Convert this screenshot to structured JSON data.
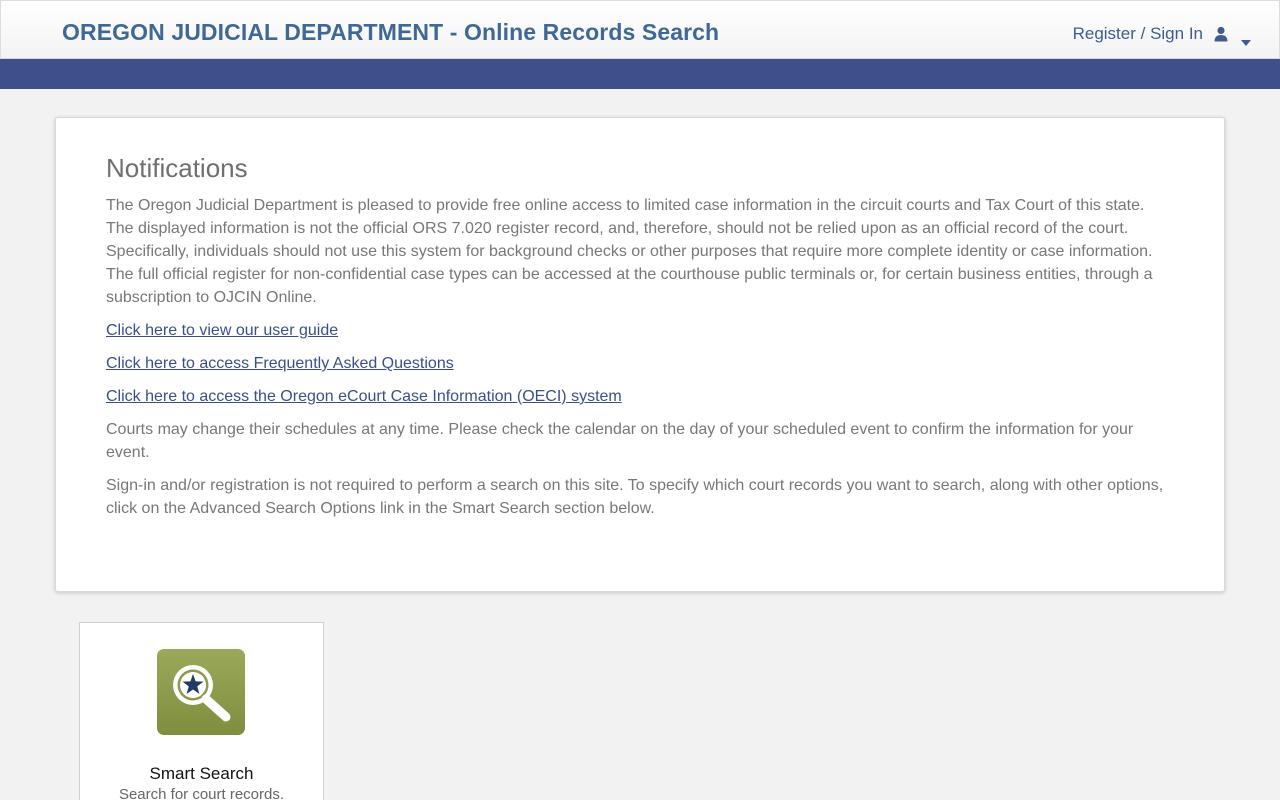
{
  "header": {
    "title": "OREGON JUDICIAL DEPARTMENT - Online Records Search",
    "account_label": "Register / Sign In",
    "user_icon": "user-icon",
    "caret_icon": "caret-down-icon"
  },
  "notifications": {
    "heading": "Notifications",
    "intro": "The Oregon Judicial Department is pleased to provide free online access to limited case information in the circuit courts and Tax Court of this state. The displayed information is not the official ORS 7.020 register record, and, therefore, should not be relied upon as an official record of the court. Specifically, individuals should not use this system for background checks or other purposes that require more complete identity or case information. The full official register for non-confidential case types can be accessed at the courthouse public terminals or, for certain business entities, through a subscription to OJCIN Online.",
    "links": [
      "Click here to view our user guide",
      "Click here to access Frequently Asked Questions",
      "Click here to access the Oregon eCourt Case Information (OECI) system"
    ],
    "schedule_note": "Courts may change their schedules at any time. Please check the calendar on the day of your scheduled event to confirm the information for your event.",
    "signin_note": "Sign-in and/or registration is not required to perform a search on this site. To specify which court records you want to search, along with other options, click on the Advanced Search Options link in the Smart Search section below."
  },
  "smart_search": {
    "title": "Smart Search",
    "subtitle": "Search for court records.",
    "icon": "magnifier-star-icon"
  },
  "colors": {
    "title_blue": "#3f6897",
    "nav_band": "#3f4f8c",
    "link_blue": "#3a4f8a",
    "icon_green": "#8a9a4a"
  }
}
